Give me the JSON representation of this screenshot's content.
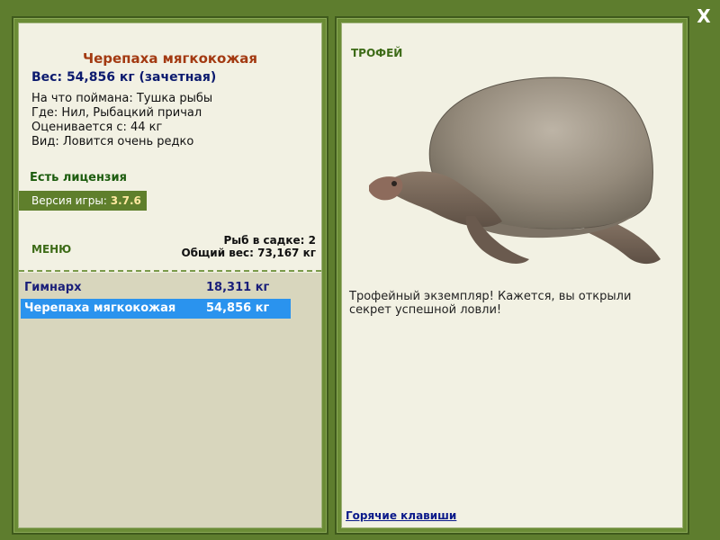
{
  "close_label": "X",
  "fish": {
    "title": "Черепаха мягкокожая",
    "weight_line": "Вес: 54,856 кг (зачетная)",
    "caught_with": "На что поймана: Тушка рыбы",
    "location": "Где: Нил, Рыбацкий причал",
    "valued_from": "Оценивается с: 44 кг",
    "rarity": "Вид: Ловится очень редко"
  },
  "license": "Есть лицензия",
  "version": {
    "label": "Версия игры:",
    "value": "3.7.6"
  },
  "menu_label": "МЕНЮ",
  "keepnet": {
    "count_line": "Рыб в садке: 2",
    "total_line": "Общий вес: 73,167 кг"
  },
  "catch_list": [
    {
      "name": "Гимнарх",
      "weight": "18,311 кг",
      "selected": false
    },
    {
      "name": "Черепаха мягкокожая",
      "weight": "54,856 кг",
      "selected": true
    }
  ],
  "trophy_label": "ТРОФЕЙ",
  "description": "Трофейный экземпляр! Кажется, вы открыли секрет успешной ловли!",
  "hotkeys_link": "Горячие клавиши",
  "colors": {
    "background": "#5e7d2e",
    "panel": "#f2f1e3",
    "title_red": "#a33a12",
    "weight_navy": "#0b1a6e",
    "selection_blue": "#2a93ee"
  },
  "icons": {
    "close": "close-icon",
    "trophy_image": "turtle-image"
  }
}
